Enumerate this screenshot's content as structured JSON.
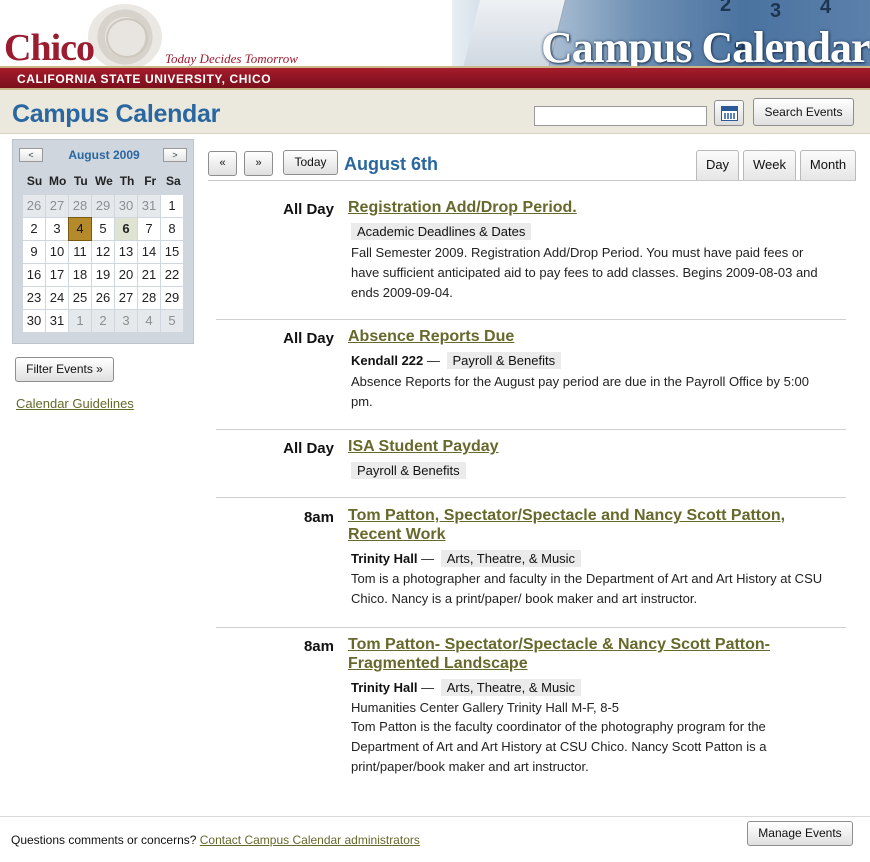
{
  "banner": {
    "logo_word": "Chico",
    "tagline": "Today Decides Tomorrow",
    "university": "CALIFORNIA STATE UNIVERSITY, CHICO",
    "title": "Campus Calendar"
  },
  "header": {
    "title": "Campus Calendar",
    "search_value": "",
    "search_button": "Search Events"
  },
  "mini_calendar": {
    "month_label": "August 2009",
    "prev": "<",
    "next": ">",
    "weekdays": [
      "Su",
      "Mo",
      "Tu",
      "We",
      "Th",
      "Fr",
      "Sa"
    ],
    "days": [
      {
        "d": "26",
        "other": true
      },
      {
        "d": "27",
        "other": true
      },
      {
        "d": "28",
        "other": true
      },
      {
        "d": "29",
        "other": true
      },
      {
        "d": "30",
        "other": true
      },
      {
        "d": "31",
        "other": true
      },
      {
        "d": "1"
      },
      {
        "d": "2"
      },
      {
        "d": "3"
      },
      {
        "d": "4",
        "selected": true
      },
      {
        "d": "5"
      },
      {
        "d": "6",
        "today": true
      },
      {
        "d": "7"
      },
      {
        "d": "8"
      },
      {
        "d": "9"
      },
      {
        "d": "10"
      },
      {
        "d": "11"
      },
      {
        "d": "12"
      },
      {
        "d": "13"
      },
      {
        "d": "14"
      },
      {
        "d": "15"
      },
      {
        "d": "16"
      },
      {
        "d": "17"
      },
      {
        "d": "18"
      },
      {
        "d": "19"
      },
      {
        "d": "20"
      },
      {
        "d": "21"
      },
      {
        "d": "22"
      },
      {
        "d": "23"
      },
      {
        "d": "24"
      },
      {
        "d": "25"
      },
      {
        "d": "26"
      },
      {
        "d": "27"
      },
      {
        "d": "28"
      },
      {
        "d": "29"
      },
      {
        "d": "30"
      },
      {
        "d": "31"
      },
      {
        "d": "1",
        "other": true
      },
      {
        "d": "2",
        "other": true
      },
      {
        "d": "3",
        "other": true
      },
      {
        "d": "4",
        "other": true
      },
      {
        "d": "5",
        "other": true
      }
    ]
  },
  "sidebar": {
    "filter_button": "Filter Events »",
    "guidelines_link": "Calendar Guidelines"
  },
  "toolbar": {
    "prev": "«",
    "next": "»",
    "today": "Today",
    "date_heading": "August 6th",
    "views": [
      "Day",
      "Week",
      "Month"
    ]
  },
  "events": [
    {
      "time": "All Day",
      "title": "Registration Add/Drop Period.",
      "location": "",
      "tags": [
        "Academic Deadlines & Dates"
      ],
      "lines": [
        "Fall Semester 2009. Registration Add/Drop Period. You must have paid fees or have sufficient anticipated aid to pay fees to add classes. Begins 2009-08-03 and ends 2009-09-04."
      ]
    },
    {
      "time": "All Day",
      "title": "Absence Reports Due",
      "location": "Kendall 222",
      "tags": [
        "Payroll & Benefits"
      ],
      "lines": [
        "Absence Reports for the August pay period are due in the Payroll Office by 5:00 pm."
      ]
    },
    {
      "time": "All Day",
      "title": "ISA Student Payday",
      "location": "",
      "tags": [
        "Payroll & Benefits"
      ],
      "lines": []
    },
    {
      "time": "8am",
      "title": "Tom Patton, Spectator/Spectacle and Nancy Scott Patton, Recent Work",
      "location": "Trinity Hall",
      "tags": [
        "Arts, Theatre, & Music"
      ],
      "lines": [
        "Tom is a photographer and faculty in the Department of Art and Art History at CSU Chico. Nancy is a print/paper/ book maker and art instructor."
      ]
    },
    {
      "time": "8am",
      "title": "Tom Patton- Spectator/Spectacle & Nancy Scott Patton- Fragmented Landscape",
      "location": "Trinity Hall",
      "tags": [
        "Arts, Theatre, & Music"
      ],
      "lines": [
        "Humanities Center Gallery Trinity Hall M-F, 8-5",
        "Tom Patton is the faculty coordinator of the photography program for the Department of Art and Art History at CSU Chico. Nancy Scott Patton is a print/paper/book maker and art instructor."
      ]
    }
  ],
  "footer": {
    "text": "Questions comments or concerns?",
    "link": "Contact Campus Calendar administrators",
    "manage_button": "Manage Events"
  },
  "colors": {
    "brand_red": "#9b1b2f",
    "heading_blue": "#2a67a0",
    "link_olive": "#66692b",
    "selected_day": "#b48a2a"
  }
}
